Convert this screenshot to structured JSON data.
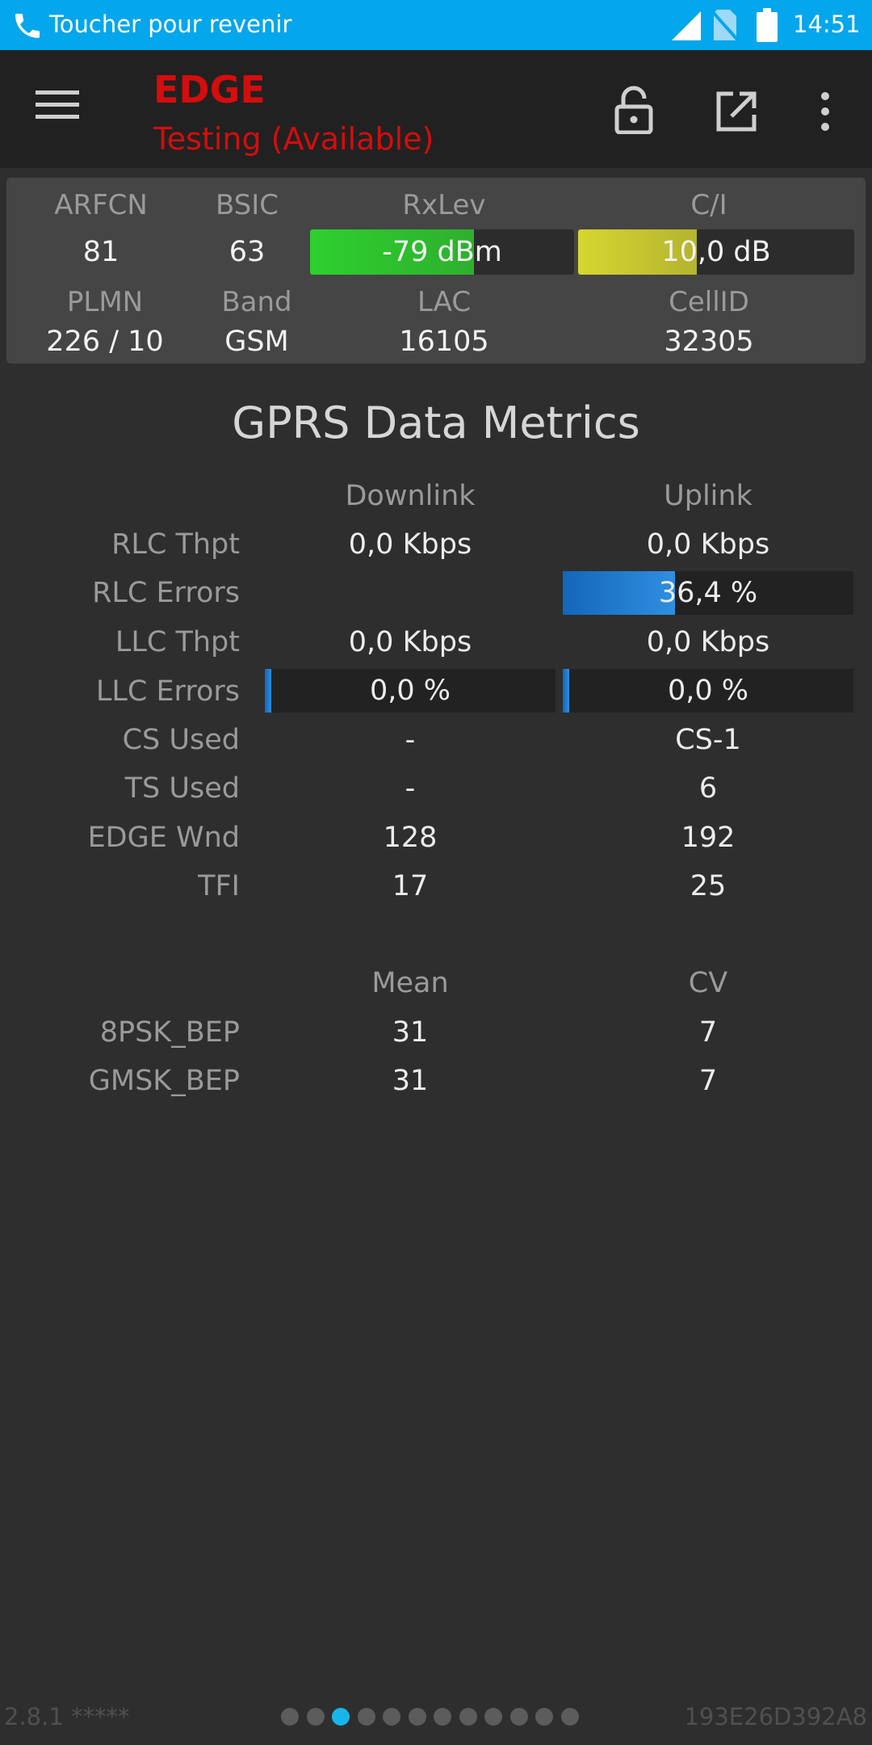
{
  "statusbar": {
    "return_text": "Toucher pour revenir",
    "clock": "14:51",
    "icons": [
      "call-icon",
      "signal-icon",
      "no-sim-icon",
      "battery-icon"
    ],
    "bg_color": "#04a6ec"
  },
  "toolbar": {
    "technology": "EDGE",
    "state": "Testing (Available)",
    "icons": [
      "menu-icon",
      "lock-icon",
      "share-icon",
      "more-icon"
    ],
    "accent_color": "#d40d0d"
  },
  "cell": {
    "labels": {
      "arfcn": "ARFCN",
      "bsic": "BSIC",
      "rxlev": "RxLev",
      "ci": "C/I",
      "plmn": "PLMN",
      "band": "Band",
      "lac": "LAC",
      "cellid": "CellID"
    },
    "values": {
      "arfcn": "81",
      "bsic": "63",
      "plmn": "226 / 10",
      "band": "GSM",
      "lac": "16105",
      "cellid": "32305"
    },
    "rxlev": {
      "text": "-79 dBm",
      "level": 0.62,
      "color": "#2ed02e"
    },
    "ci": {
      "text": "10,0 dB",
      "level": 0.43,
      "color": "#d6d630"
    }
  },
  "gprs": {
    "title": "GPRS Data Metrics",
    "downlink_label": "Downlink",
    "uplink_label": "Uplink",
    "rows": {
      "rlc_thpt": {
        "label": "RLC Thpt",
        "dl": "0,0 Kbps",
        "ul": "0,0 Kbps"
      },
      "rlc_errors": {
        "label": "RLC Errors",
        "dl": "",
        "ul": "36,4 %",
        "ul_level": 0.364
      },
      "llc_thpt": {
        "label": "LLC Thpt",
        "dl": "0,0 Kbps",
        "ul": "0,0 Kbps"
      },
      "llc_errors": {
        "label": "LLC Errors",
        "dl": "0,0 %",
        "ul": "0,0 %",
        "dl_level": 0.0,
        "ul_level": 0.0
      },
      "cs_used": {
        "label": "CS Used",
        "dl": "-",
        "ul": "CS-1"
      },
      "ts_used": {
        "label": "TS Used",
        "dl": "-",
        "ul": "6"
      },
      "edge_wnd": {
        "label": "EDGE Wnd",
        "dl": "128",
        "ul": "192"
      },
      "tfi": {
        "label": "TFI",
        "dl": "17",
        "ul": "25"
      }
    },
    "bep": {
      "mean_label": "Mean",
      "cv_label": "CV",
      "rows": {
        "psk": {
          "label": "8PSK_BEP",
          "mean": "31",
          "cv": "7"
        },
        "gmsk": {
          "label": "GMSK_BEP",
          "mean": "31",
          "cv": "7"
        }
      }
    }
  },
  "footer": {
    "version": "2.8.1 *****",
    "device_id": "193E26D392A8",
    "pages": 12,
    "active_page": 3
  }
}
